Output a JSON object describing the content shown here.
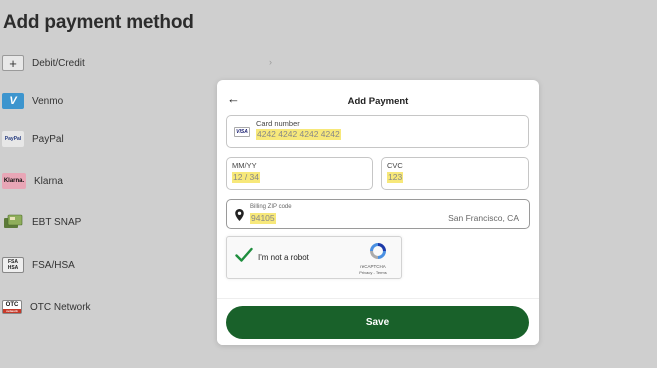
{
  "page_title": "Add payment method",
  "methods": [
    {
      "label": "Debit/Credit",
      "icon": "plus-icon",
      "logo_text": "+"
    },
    {
      "label": "Venmo",
      "icon": "venmo-logo",
      "logo_text": "V"
    },
    {
      "label": "PayPal",
      "icon": "paypal-logo",
      "logo_text": "PayPal"
    },
    {
      "label": "Klarna",
      "icon": "klarna-logo",
      "logo_text": "Klarna."
    },
    {
      "label": "EBT SNAP",
      "icon": "ebt-card-icon",
      "logo_text": ""
    },
    {
      "label": "FSA/HSA",
      "icon": "fsa-hsa-logo",
      "logo_text": "FSA HSA"
    },
    {
      "label": "OTC Network",
      "icon": "otc-logo",
      "logo_text": "OTC"
    }
  ],
  "modal": {
    "title": "Add Payment",
    "card_number": {
      "label": "Card number",
      "value": "4242 4242 4242 4242",
      "brand": "VISA"
    },
    "expiry": {
      "label": "MM/YY",
      "value": "12 / 34"
    },
    "cvc": {
      "label": "CVC",
      "value": "123"
    },
    "zip": {
      "label": "Billing ZIP code",
      "value": "94105",
      "city": "San Francisco, CA"
    },
    "captcha": {
      "label": "I'm not a robot",
      "brand": "reCAPTCHA",
      "links": "Privacy - Terms"
    },
    "save_label": "Save"
  },
  "colors": {
    "background": "#cfcfcf",
    "save_button": "#19612a",
    "highlight": "#f7e87a",
    "check": "#1e8e3e"
  }
}
